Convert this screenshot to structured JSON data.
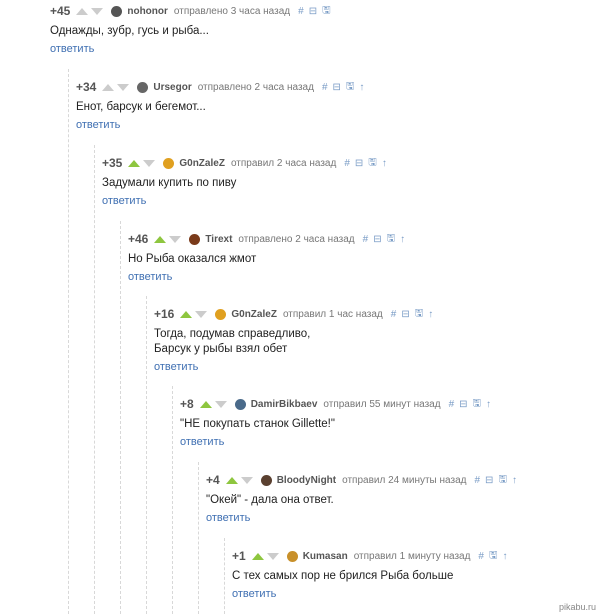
{
  "comments": [
    {
      "rating": "+45",
      "up_active": false,
      "user": "nohonor",
      "meta": "отправлено 3 часа назад",
      "text": [
        "Однажды, зубр, гусь и рыба..."
      ],
      "reply": "ответить",
      "avatar_color": "#555",
      "icons": [
        "#",
        "⊟",
        "🖫"
      ]
    },
    {
      "rating": "+34",
      "up_active": false,
      "user": "Ursegor",
      "meta": "отправлено 2 часа назад",
      "text": [
        "Енот, барсук и бегемот..."
      ],
      "reply": "ответить",
      "avatar_color": "#666",
      "icons": [
        "#",
        "⊟",
        "🖫",
        "↑"
      ]
    },
    {
      "rating": "+35",
      "up_active": true,
      "user": "G0nZaleZ",
      "meta": "отправил 2 часа назад",
      "text": [
        "Задумали купить по пиву"
      ],
      "reply": "ответить",
      "avatar_color": "#e0a020",
      "icons": [
        "#",
        "⊟",
        "🖫",
        "↑"
      ]
    },
    {
      "rating": "+46",
      "up_active": true,
      "user": "Tirext",
      "meta": "отправлено 2 часа назад",
      "text": [
        "Но Рыба оказался жмот"
      ],
      "reply": "ответить",
      "avatar_color": "#7a3a1a",
      "icons": [
        "#",
        "⊟",
        "🖫",
        "↑"
      ]
    },
    {
      "rating": "+16",
      "up_active": true,
      "user": "G0nZaleZ",
      "meta": "отправил 1 час назад",
      "text": [
        "Тогда, подумав справедливо,",
        "Барсук у рыбы взял обет"
      ],
      "reply": "ответить",
      "avatar_color": "#e0a020",
      "icons": [
        "#",
        "⊟",
        "🖫",
        "↑"
      ]
    },
    {
      "rating": "+8",
      "up_active": true,
      "user": "DamirBikbaev",
      "meta": "отправил 55 минут назад",
      "text": [
        "\"НЕ покупать станок Gillette!\""
      ],
      "reply": "ответить",
      "avatar_color": "#4a6a8a",
      "icons": [
        "#",
        "⊟",
        "🖫",
        "↑"
      ]
    },
    {
      "rating": "+4",
      "up_active": true,
      "user": "BloodyNight",
      "meta": "отправил 24 минуты назад",
      "text": [
        "\"Окей\" - дала она ответ."
      ],
      "reply": "ответить",
      "avatar_color": "#5a4030",
      "icons": [
        "#",
        "⊟",
        "🖫",
        "↑"
      ]
    },
    {
      "rating": "+1",
      "up_active": true,
      "user": "Kumasan",
      "meta": "отправил 1 минуту назад",
      "text": [
        "С тех самых пор не брился Рыба больше"
      ],
      "reply": "ответить",
      "avatar_color": "#c8902a",
      "icons": [
        "#",
        "🖫",
        "↑"
      ]
    }
  ],
  "footer": "pikabu.ru"
}
